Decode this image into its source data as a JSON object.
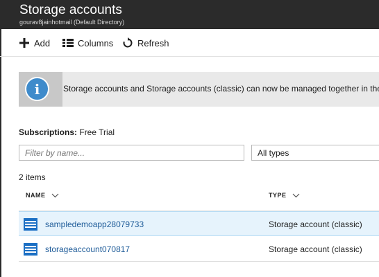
{
  "header": {
    "title": "Storage accounts",
    "subtitle": "gourav8jainhotmail (Default Directory)"
  },
  "toolbar": {
    "add_label": "Add",
    "columns_label": "Columns",
    "refresh_label": "Refresh"
  },
  "banner": {
    "icon": "info-icon",
    "text": "Storage accounts and Storage accounts (classic) can now be managed together in the"
  },
  "subscriptions": {
    "label": "Subscriptions:",
    "value": "Free Trial"
  },
  "filter": {
    "placeholder": "Filter by name...",
    "type_selected": "All types"
  },
  "items_count": "2 items",
  "table": {
    "columns": [
      "NAME",
      "TYPE"
    ],
    "rows": [
      {
        "name": "sampledemoapp28079733",
        "type": "Storage account (classic)",
        "icon": "storage-account-icon",
        "selected": true
      },
      {
        "name": "storageaccount070817",
        "type": "Storage account (classic)",
        "icon": "storage-account-icon",
        "selected": false
      }
    ]
  },
  "colors": {
    "header_bg": "#2b2b2b",
    "link": "#1f5c99",
    "selected_row": "#e6f3fc",
    "info_blue": "#3f8bcb"
  }
}
